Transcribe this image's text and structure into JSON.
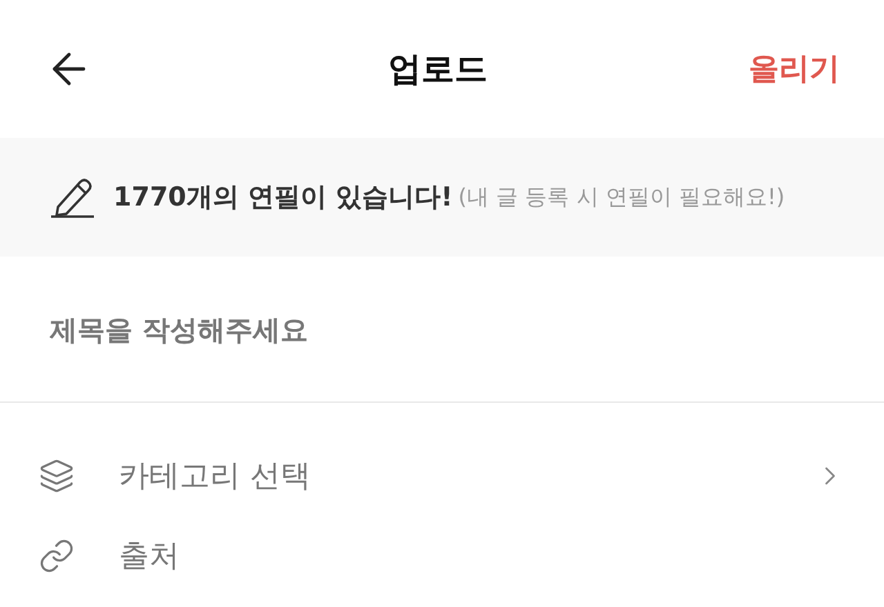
{
  "header": {
    "title": "업로드",
    "action": "올리기"
  },
  "banner": {
    "message": "1770개의 연필이 있습니다!",
    "note": "(내 글 등록 시 연필이 필요해요!)"
  },
  "title_field": {
    "placeholder": "제목을 작성해주세요"
  },
  "options": [
    {
      "kind": "category",
      "label": "카테고리 선택",
      "chevron": true
    },
    {
      "kind": "source",
      "label": "출처",
      "chevron": false
    }
  ]
}
